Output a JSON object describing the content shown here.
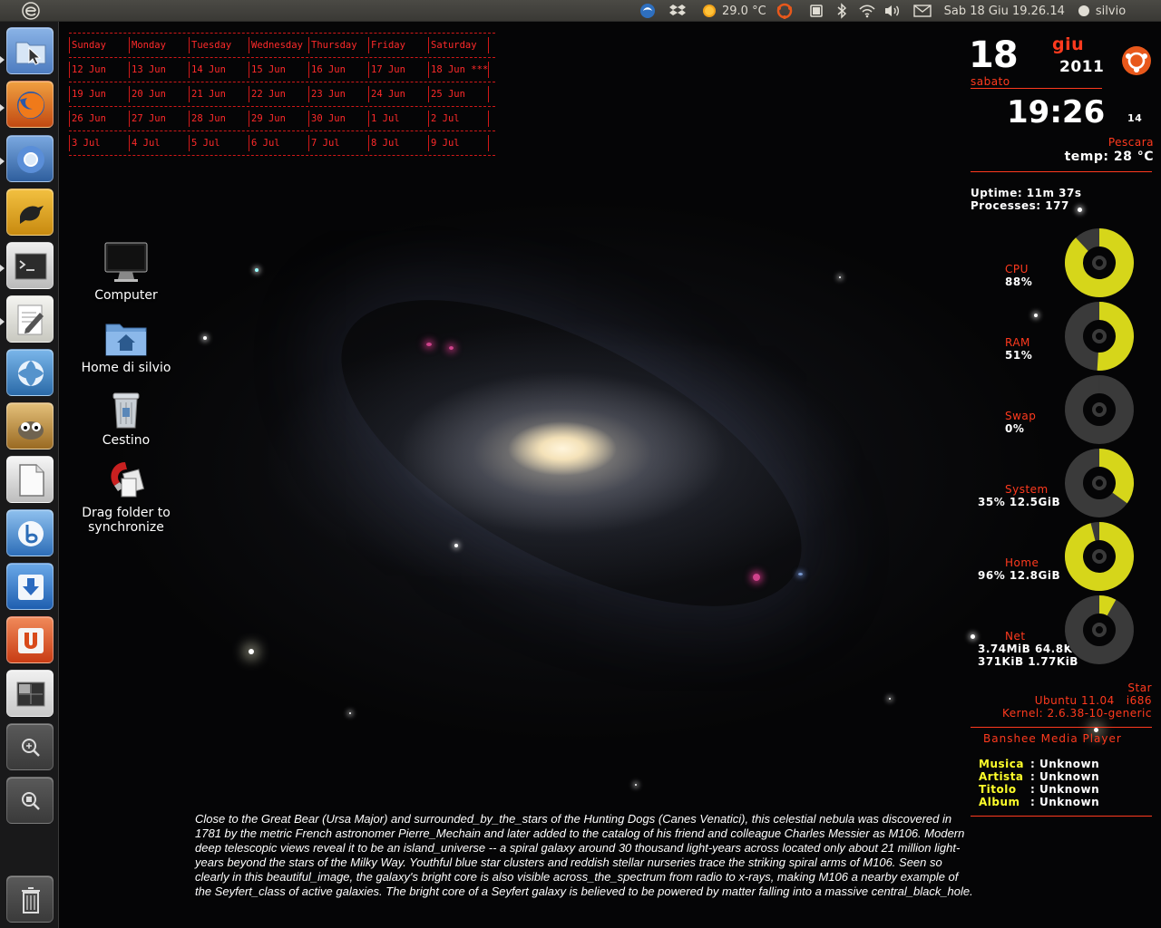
{
  "top_panel": {
    "weather": "29.0 °C",
    "datetime": "Sab 18 Giu 19.26.14",
    "user": "silvio"
  },
  "launcher": {
    "items": [
      {
        "name": "files",
        "color": "#4d7cc0"
      },
      {
        "name": "firefox",
        "color": "#e05a1b"
      },
      {
        "name": "chromium",
        "color": "#3c78c8"
      },
      {
        "name": "gwibber",
        "color": "#d8a020"
      },
      {
        "name": "terminal",
        "color": "#3b3b3b"
      },
      {
        "name": "text-editor",
        "color": "#d8d8d0"
      },
      {
        "name": "shotwell",
        "color": "#2f7bbf"
      },
      {
        "name": "gimp",
        "color": "#b88a3a"
      },
      {
        "name": "libreoffice",
        "color": "#d8d8d8"
      },
      {
        "name": "banshee",
        "color": "#3a7dc8"
      },
      {
        "name": "software-center",
        "color": "#2a78c8"
      },
      {
        "name": "ubuntu-one",
        "color": "#d8502a"
      },
      {
        "name": "workspace-switcher",
        "color": "#ddd"
      },
      {
        "name": "zoom-in",
        "color": "#555"
      },
      {
        "name": "zoom-out",
        "color": "#555"
      },
      {
        "name": "trash",
        "color": "#555"
      }
    ]
  },
  "desktop_icons": [
    {
      "label": "Computer"
    },
    {
      "label": "Home di silvio"
    },
    {
      "label": "Cestino"
    },
    {
      "label": "Drag folder to synchronize"
    }
  ],
  "calendar": {
    "headers": [
      "Sunday",
      "Monday",
      "Tuesday",
      "Wednesday",
      "Thursday",
      "Friday",
      "Saturday"
    ],
    "weeks": [
      [
        "12 Jun",
        "13 Jun",
        "14 Jun",
        "15 Jun",
        "16 Jun",
        "17 Jun",
        "18 Jun ***"
      ],
      [
        "19 Jun",
        "20 Jun",
        "21 Jun",
        "22 Jun",
        "23 Jun",
        "24 Jun",
        "25 Jun"
      ],
      [
        "26 Jun",
        "27 Jun",
        "28 Jun",
        "29 Jun",
        "30 Jun",
        " 1 Jul",
        " 2 Jul"
      ],
      [
        " 3 Jul",
        " 4 Jul",
        " 5 Jul",
        " 6 Jul",
        " 7 Jul",
        " 8 Jul",
        " 9 Jul"
      ]
    ]
  },
  "conky": {
    "day": "18",
    "month": "giu",
    "year": "2011",
    "weekday": "sabato",
    "time": "19:26",
    "seconds": "14",
    "city": "Pescara",
    "temp": "temp: 28 °C",
    "uptime": "Uptime: 11m 37s",
    "processes": "Processes: 177",
    "meters": [
      {
        "label": "CPU",
        "value": "88%",
        "fraction": 0.88
      },
      {
        "label": "RAM",
        "value": "51%",
        "fraction": 0.51
      },
      {
        "label": "Swap",
        "value": "0%",
        "fraction": 0.0
      },
      {
        "label": "System",
        "value": "35% 12.5GiB",
        "fraction": 0.35
      },
      {
        "label": "Home",
        "value": "96% 12.8GiB",
        "fraction": 0.96
      },
      {
        "label": "Net",
        "value": "3.74MiB 64.8KiB",
        "value2": "371KiB 1.77KiB",
        "fraction": 0.08
      }
    ],
    "star": "Star",
    "distro": "Ubuntu 11.04   i686",
    "kernel": "Kernel: 2.6.38-10-generic",
    "player_title": "Banshee Media Player",
    "player": [
      {
        "key": "Musica",
        "value": ": Unknown"
      },
      {
        "key": "Artista",
        "value": ": Unknown"
      },
      {
        "key": "Titolo",
        "value": ": Unknown"
      },
      {
        "key": "Album",
        "value": ": Unknown"
      }
    ],
    "colors": {
      "accent": "#ff3a1e",
      "gauge": "#d6d61a",
      "track": "#3a3a3a",
      "label": "#ffff2a"
    }
  },
  "description": "Close to the Great Bear (Ursa Major) and surrounded_by_the_stars of the Hunting Dogs (Canes Venatici), this celestial nebula was discovered in 1781 by the metric French astronomer Pierre_Mechain and later added to the catalog of his friend and colleague Charles Messier as M106. Modern deep telescopic views reveal it to be an island_universe -- a spiral galaxy around 30 thousand light-years across located only about 21 million light-years beyond the stars of the Milky Way. Youthful blue star clusters and reddish stellar nurseries trace the striking spiral arms of M106. Seen so clearly in this beautiful_image, the galaxy's bright core is also visible across_the_spectrum from radio to x-rays, making M106 a nearby example of the Seyfert_class of active galaxies. The bright core of a Seyfert galaxy is believed to be powered by matter falling into a massive central_black_hole."
}
